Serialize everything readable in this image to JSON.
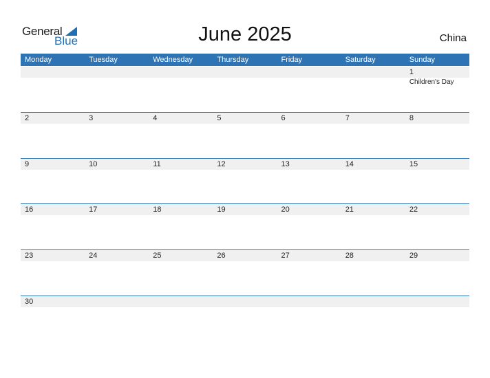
{
  "logo": {
    "line1": "General",
    "line2": "Blue"
  },
  "title": "June 2025",
  "country": "China",
  "weekdays": [
    "Monday",
    "Tuesday",
    "Wednesday",
    "Thursday",
    "Friday",
    "Saturday",
    "Sunday"
  ],
  "weeks": [
    [
      "",
      "",
      "",
      "",
      "",
      "",
      {
        "day": "1",
        "holiday": "Children's Day"
      }
    ],
    [
      "2",
      "3",
      "4",
      "5",
      "6",
      "7",
      "8"
    ],
    [
      "9",
      "10",
      "11",
      "12",
      "13",
      "14",
      "15"
    ],
    [
      "16",
      "17",
      "18",
      "19",
      "20",
      "21",
      "22"
    ],
    [
      "23",
      "24",
      "25",
      "26",
      "27",
      "28",
      "29"
    ],
    [
      "30",
      "",
      "",
      "",
      "",
      "",
      ""
    ]
  ],
  "colors": {
    "accent": "#2e74b5",
    "band": "#f0f0f0"
  }
}
